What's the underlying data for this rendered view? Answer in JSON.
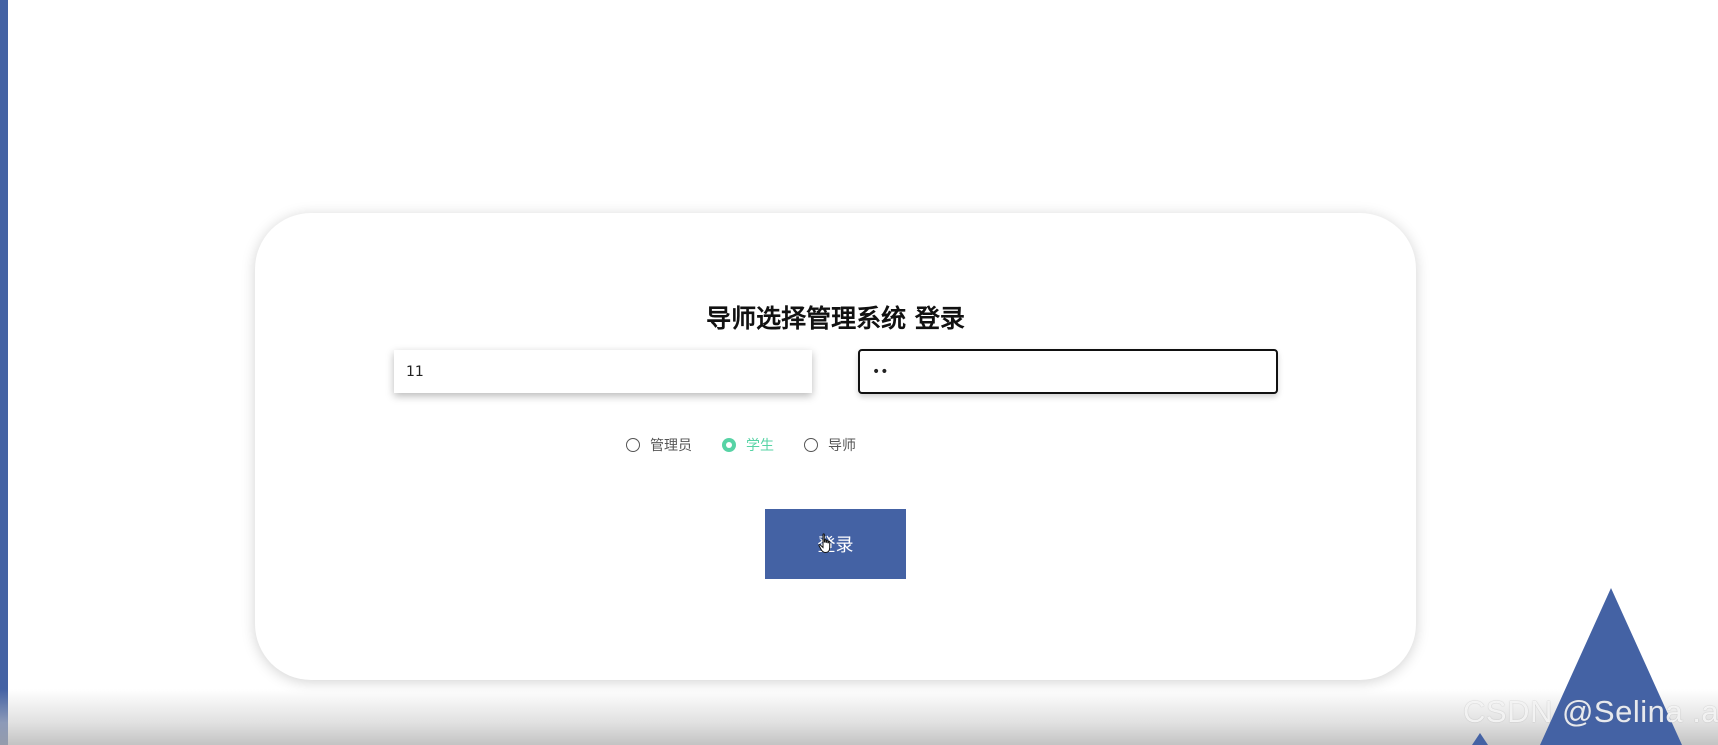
{
  "login_card": {
    "title": "导师选择管理系统 登录",
    "username_value": "11",
    "password_value": "••",
    "roles": [
      {
        "label": "管理员",
        "checked": false
      },
      {
        "label": "学生",
        "checked": true
      },
      {
        "label": "导师",
        "checked": false
      }
    ],
    "login_button_label": "登录"
  },
  "watermark": "CSDN @Selina .a",
  "colors": {
    "primary": "#4462a4",
    "radio_checked": "#57d3a5"
  },
  "icons": {
    "cursor": "hand-pointer-icon"
  }
}
